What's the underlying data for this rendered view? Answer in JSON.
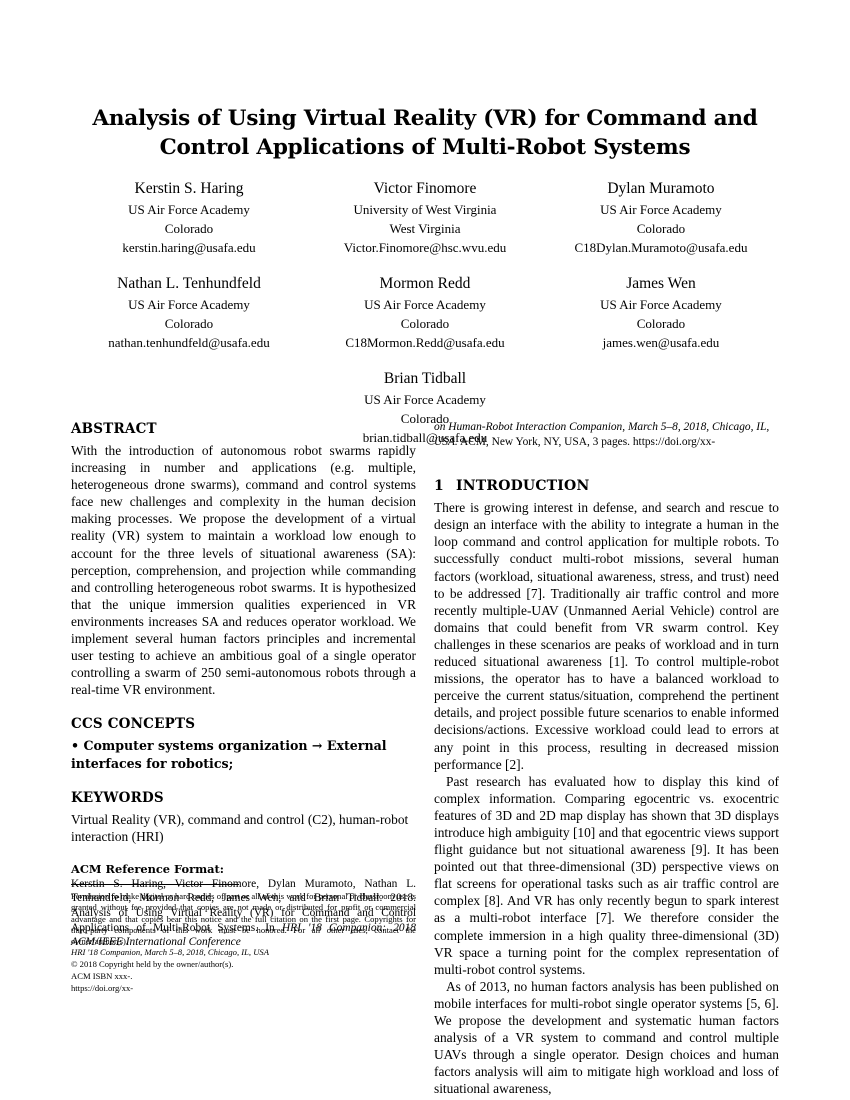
{
  "paper": {
    "title": "Analysis of Using Virtual Reality (VR) for Command and Control Applications of Multi-Robot Systems"
  },
  "authors": [
    {
      "name": "Kerstin S. Haring",
      "affiliation": "US Air Force Academy",
      "location": "Colorado",
      "email": "kerstin.haring@usafa.edu"
    },
    {
      "name": "Victor Finomore",
      "affiliation": "University of West Virginia",
      "location": "West Virginia",
      "email": "Victor.Finomore@hsc.wvu.edu"
    },
    {
      "name": "Dylan Muramoto",
      "affiliation": "US Air Force Academy",
      "location": "Colorado",
      "email": "C18Dylan.Muramoto@usafa.edu"
    },
    {
      "name": "Nathan L. Tenhundfeld",
      "affiliation": "US Air Force Academy",
      "location": "Colorado",
      "email": "nathan.tenhundfeld@usafa.edu"
    },
    {
      "name": "Mormon Redd",
      "affiliation": "US Air Force Academy",
      "location": "Colorado",
      "email": "C18Mormon.Redd@usafa.edu"
    },
    {
      "name": "James Wen",
      "affiliation": "US Air Force Academy",
      "location": "Colorado",
      "email": "james.wen@usafa.edu"
    },
    {
      "name": "Brian Tidball",
      "affiliation": "US Air Force Academy",
      "location": "Colorado",
      "email": "brian.tidball@usafa.edu"
    }
  ],
  "abstract": {
    "heading": "ABSTRACT",
    "text": "With the introduction of autonomous robot swarms rapidly increasing in number and applications (e.g. multiple, heterogeneous drone swarms), command and control systems face new challenges and complexity in the human decision making processes. We propose the development of a virtual reality (VR) system to maintain a workload low enough to account for the three levels of situational awareness (SA): perception, comprehension, and projection while commanding and controlling heterogeneous robot swarms. It is hypothesized that the unique immersion qualities experienced in VR environments increases SA and reduces operator workload. We implement several human factors principles and incremental user testing to achieve an ambitious goal of a single operator controlling a swarm of 250 semi-autonomous robots through a real-time VR environment."
  },
  "ccs": {
    "heading": "CCS CONCEPTS",
    "bullet": "•",
    "text": "Computer systems organization → External interfaces for robotics;"
  },
  "keywords": {
    "heading": "KEYWORDS",
    "text": "Virtual Reality (VR), command and control (C2), human-robot interaction (HRI)"
  },
  "acm_reference": {
    "heading": "ACM Reference Format:",
    "part1": "Kerstin S. Haring, Victor Finomore, Dylan Muramoto, Nathan L. Tenhundfeld, Mormon Redd, James Wen, and Brian Tidball. 2018. Analysis of Using Virtual Reality (VR) for Command and Control Applications of Multi-Robot Systems. In ",
    "italic1": "HRI '18 Companion: 2018 ACM/IEEE International Conference",
    "italic2": "on Human-Robot Interaction Companion, March 5–8, 2018, Chicago, IL, USA.",
    "part2": " ACM, New York, NY, USA, 3 pages. https://doi.org/xx-"
  },
  "footnote": {
    "permission": "Permission to make digital or hard copies of part or all of this work for personal or classroom use is granted without fee provided that copies are not made or distributed for profit or commercial advantage and that copies bear this notice and the full citation on the first page. Copyrights for third-party components of this work must be honored. For all other uses, contact the owner/author(s).",
    "venue": "HRI '18 Companion, March 5–8, 2018, Chicago, IL, USA",
    "copyright": "© 2018 Copyright held by the owner/author(s).",
    "isbn": "ACM ISBN xxx-.",
    "doi": "https://doi.org/xx-"
  },
  "introduction": {
    "number": "1",
    "heading": "INTRODUCTION",
    "para1": "There is growing interest in defense, and search and rescue to design an interface with the ability to integrate a human in the loop command and control application for multiple robots. To successfully conduct multi-robot missions, several human factors (workload, situational awareness, stress, and trust) need to be addressed [7]. Traditionally air traffic control and more recently multiple-UAV (Unmanned Aerial Vehicle) control are domains that could benefit from VR swarm control. Key challenges in these scenarios are peaks of workload and in turn reduced situational awareness [1]. To control multiple-robot missions, the operator has to have a balanced workload to perceive the current status/situation, comprehend the pertinent details, and project possible future scenarios to enable informed decisions/actions. Excessive workload could lead to errors at any point in this process, resulting in decreased mission performance [2].",
    "para2": "Past research has evaluated how to display this kind of complex information. Comparing egocentric vs. exocentric features of 3D and 2D map display has shown that 3D displays introduce high ambiguity [10] and that egocentric views support flight guidance but not situational awareness [9]. It has been pointed out that three-dimensional (3D) perspective views on flat screens for operational tasks such as air traffic control are complex [8]. And VR has only recently begun to spark interest as a multi-robot interface [7]. We therefore consider the complete immersion in a high quality three-dimensional (3D) VR space a turning point for the complex representation of multi-robot control systems.",
    "para3": "As of 2013, no human factors analysis has been published on mobile interfaces for multi-robot single operator systems [5, 6]. We propose the development and systematic human factors analysis of a VR system to command and control multiple UAVs through a single operator. Design choices and human factors analysis will aim to mitigate high workload and loss of situational awareness,"
  }
}
